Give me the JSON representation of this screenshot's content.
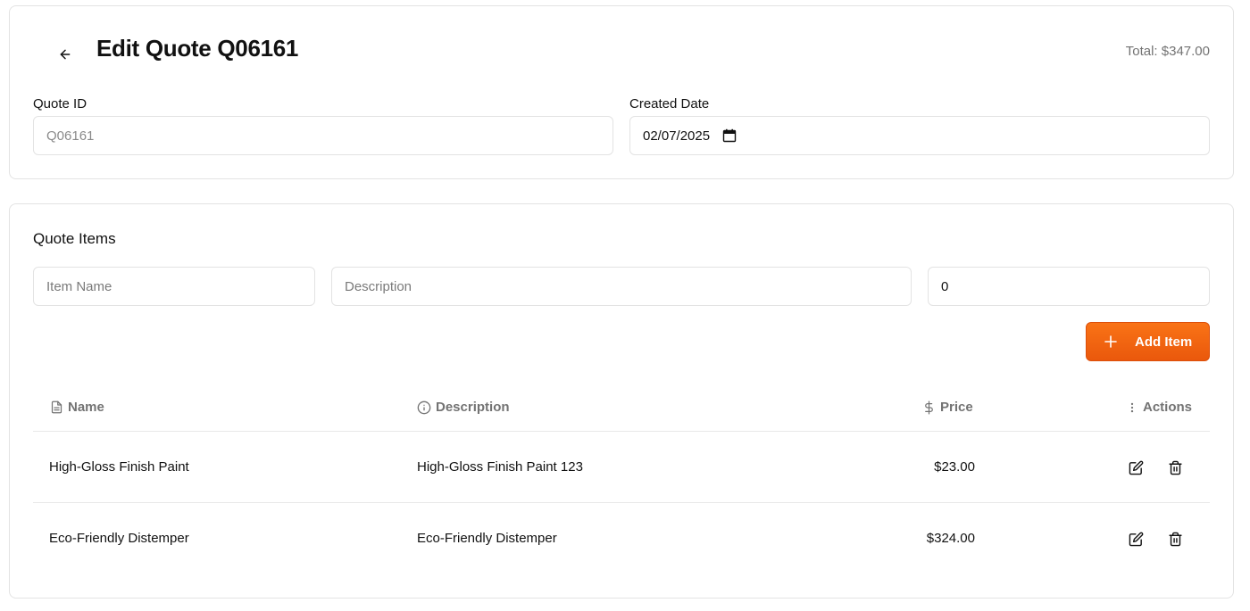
{
  "header": {
    "back_icon": "arrow-left-icon",
    "title": "Edit Quote Q06161",
    "total": "Total: $347.00"
  },
  "fields": {
    "quote_id_label": "Quote ID",
    "quote_id_value": "Q06161",
    "created_date_label": "Created Date",
    "created_date_value": "02/07/2025"
  },
  "items_section": {
    "title": "Quote Items",
    "item_name_placeholder": "Item Name",
    "description_placeholder": "Description",
    "price_value": "0",
    "add_button_label": "Add Item",
    "add_button_color": "#f97316"
  },
  "table": {
    "headers": {
      "name": "Name",
      "description": "Description",
      "price": "Price",
      "actions": "Actions"
    },
    "header_icons": [
      "file-text-icon",
      "info-icon",
      "dollar-icon",
      "more-vertical-icon"
    ],
    "rows": [
      {
        "name": "High-Gloss Finish Paint",
        "description": "High-Gloss Finish Paint 123",
        "price": "$23.00"
      },
      {
        "name": "Eco-Friendly Distemper",
        "description": "Eco-Friendly Distemper",
        "price": "$324.00"
      }
    ],
    "row_action_icons": [
      "edit-icon",
      "trash-icon"
    ]
  }
}
